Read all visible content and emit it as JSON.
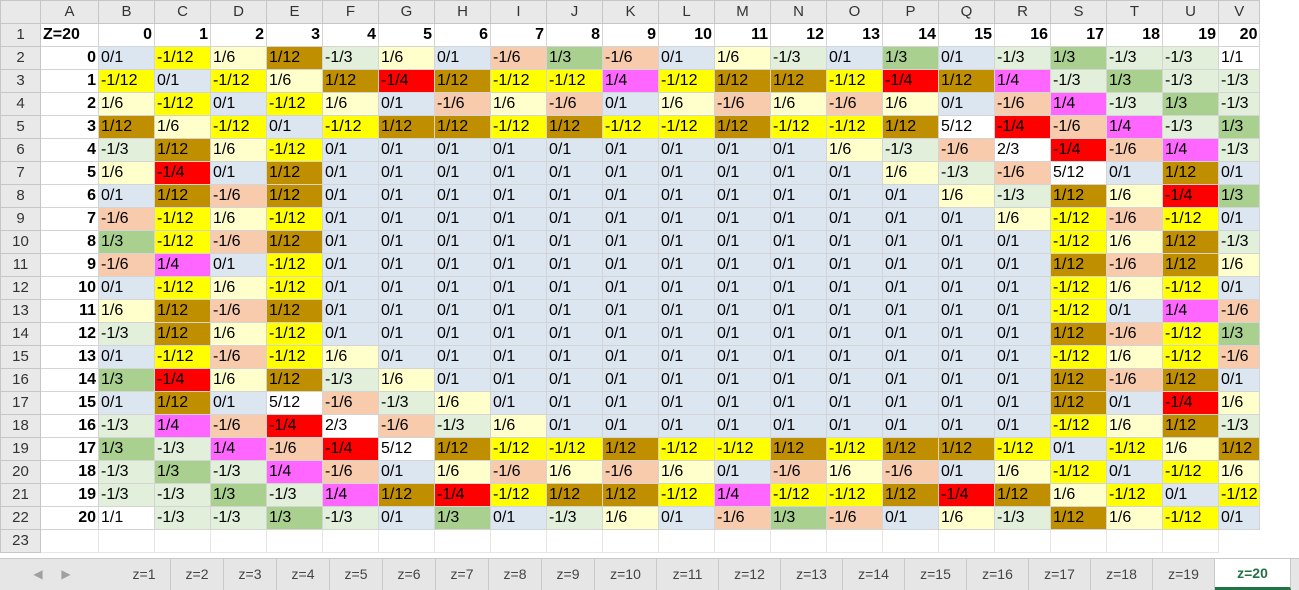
{
  "corner_label": "",
  "column_letters": [
    "A",
    "B",
    "C",
    "D",
    "E",
    "F",
    "G",
    "H",
    "I",
    "J",
    "K",
    "L",
    "M",
    "N",
    "O",
    "P",
    "Q",
    "R",
    "S",
    "T",
    "U",
    "V"
  ],
  "row_numbers": [
    "1",
    "2",
    "3",
    "4",
    "5",
    "6",
    "7",
    "8",
    "9",
    "10",
    "11",
    "12",
    "13",
    "14",
    "15",
    "16",
    "17",
    "18",
    "19",
    "20",
    "21",
    "22",
    "23"
  ],
  "z_label": "Z=20",
  "x_headers": [
    "0",
    "1",
    "2",
    "3",
    "4",
    "5",
    "6",
    "7",
    "8",
    "9",
    "10",
    "11",
    "12",
    "13",
    "14",
    "15",
    "16",
    "17",
    "18",
    "19",
    "20"
  ],
  "y_headers": [
    "0",
    "1",
    "2",
    "3",
    "4",
    "5",
    "6",
    "7",
    "8",
    "9",
    "10",
    "11",
    "12",
    "13",
    "14",
    "15",
    "16",
    "17",
    "18",
    "19",
    "20"
  ],
  "rows": [
    [
      "0/1",
      "-1/12",
      "1/6",
      "1/12",
      "-1/3",
      "1/6",
      "0/1",
      "-1/6",
      "1/3",
      "-1/6",
      "0/1",
      "1/6",
      "-1/3",
      "0/1",
      "1/3",
      "0/1",
      "-1/3",
      "1/3",
      "-1/3",
      "-1/3",
      "1/1"
    ],
    [
      "-1/12",
      "0/1",
      "-1/12",
      "1/6",
      "1/12",
      "-1/4",
      "1/12",
      "-1/12",
      "-1/12",
      "1/4",
      "-1/12",
      "1/12",
      "1/12",
      "-1/12",
      "-1/4",
      "1/12",
      "1/4",
      "-1/3",
      "1/3",
      "-1/3",
      "-1/3"
    ],
    [
      "1/6",
      "-1/12",
      "0/1",
      "-1/12",
      "1/6",
      "0/1",
      "-1/6",
      "1/6",
      "-1/6",
      "0/1",
      "1/6",
      "-1/6",
      "1/6",
      "-1/6",
      "1/6",
      "0/1",
      "-1/6",
      "1/4",
      "-1/3",
      "1/3",
      "-1/3"
    ],
    [
      "1/12",
      "1/6",
      "-1/12",
      "0/1",
      "-1/12",
      "1/12",
      "1/12",
      "-1/12",
      "1/12",
      "-1/12",
      "-1/12",
      "1/12",
      "-1/12",
      "-1/12",
      "1/12",
      "5/12",
      "-1/4",
      "-1/6",
      "1/4",
      "-1/3",
      "1/3"
    ],
    [
      "-1/3",
      "1/12",
      "1/6",
      "-1/12",
      "0/1",
      "0/1",
      "0/1",
      "0/1",
      "0/1",
      "0/1",
      "0/1",
      "0/1",
      "0/1",
      "1/6",
      "-1/3",
      "-1/6",
      "2/3",
      "-1/4",
      "-1/6",
      "1/4",
      "-1/3"
    ],
    [
      "1/6",
      "-1/4",
      "0/1",
      "1/12",
      "0/1",
      "0/1",
      "0/1",
      "0/1",
      "0/1",
      "0/1",
      "0/1",
      "0/1",
      "0/1",
      "0/1",
      "1/6",
      "-1/3",
      "-1/6",
      "5/12",
      "0/1",
      "1/12",
      "0/1"
    ],
    [
      "0/1",
      "1/12",
      "-1/6",
      "1/12",
      "0/1",
      "0/1",
      "0/1",
      "0/1",
      "0/1",
      "0/1",
      "0/1",
      "0/1",
      "0/1",
      "0/1",
      "0/1",
      "1/6",
      "-1/3",
      "1/12",
      "1/6",
      "-1/4",
      "1/3"
    ],
    [
      "-1/6",
      "-1/12",
      "1/6",
      "-1/12",
      "0/1",
      "0/1",
      "0/1",
      "0/1",
      "0/1",
      "0/1",
      "0/1",
      "0/1",
      "0/1",
      "0/1",
      "0/1",
      "0/1",
      "1/6",
      "-1/12",
      "-1/6",
      "-1/12",
      "0/1"
    ],
    [
      "1/3",
      "-1/12",
      "-1/6",
      "1/12",
      "0/1",
      "0/1",
      "0/1",
      "0/1",
      "0/1",
      "0/1",
      "0/1",
      "0/1",
      "0/1",
      "0/1",
      "0/1",
      "0/1",
      "0/1",
      "-1/12",
      "1/6",
      "1/12",
      "-1/3"
    ],
    [
      "-1/6",
      "1/4",
      "0/1",
      "-1/12",
      "0/1",
      "0/1",
      "0/1",
      "0/1",
      "0/1",
      "0/1",
      "0/1",
      "0/1",
      "0/1",
      "0/1",
      "0/1",
      "0/1",
      "0/1",
      "1/12",
      "-1/6",
      "1/12",
      "1/6"
    ],
    [
      "0/1",
      "-1/12",
      "1/6",
      "-1/12",
      "0/1",
      "0/1",
      "0/1",
      "0/1",
      "0/1",
      "0/1",
      "0/1",
      "0/1",
      "0/1",
      "0/1",
      "0/1",
      "0/1",
      "0/1",
      "-1/12",
      "1/6",
      "-1/12",
      "0/1"
    ],
    [
      "1/6",
      "1/12",
      "-1/6",
      "1/12",
      "0/1",
      "0/1",
      "0/1",
      "0/1",
      "0/1",
      "0/1",
      "0/1",
      "0/1",
      "0/1",
      "0/1",
      "0/1",
      "0/1",
      "0/1",
      "-1/12",
      "0/1",
      "1/4",
      "-1/6"
    ],
    [
      "-1/3",
      "1/12",
      "1/6",
      "-1/12",
      "0/1",
      "0/1",
      "0/1",
      "0/1",
      "0/1",
      "0/1",
      "0/1",
      "0/1",
      "0/1",
      "0/1",
      "0/1",
      "0/1",
      "0/1",
      "1/12",
      "-1/6",
      "-1/12",
      "1/3"
    ],
    [
      "0/1",
      "-1/12",
      "-1/6",
      "-1/12",
      "1/6",
      "0/1",
      "0/1",
      "0/1",
      "0/1",
      "0/1",
      "0/1",
      "0/1",
      "0/1",
      "0/1",
      "0/1",
      "0/1",
      "0/1",
      "-1/12",
      "1/6",
      "-1/12",
      "-1/6"
    ],
    [
      "1/3",
      "-1/4",
      "1/6",
      "1/12",
      "-1/3",
      "1/6",
      "0/1",
      "0/1",
      "0/1",
      "0/1",
      "0/1",
      "0/1",
      "0/1",
      "0/1",
      "0/1",
      "0/1",
      "0/1",
      "1/12",
      "-1/6",
      "1/12",
      "0/1"
    ],
    [
      "0/1",
      "1/12",
      "0/1",
      "5/12",
      "-1/6",
      "-1/3",
      "1/6",
      "0/1",
      "0/1",
      "0/1",
      "0/1",
      "0/1",
      "0/1",
      "0/1",
      "0/1",
      "0/1",
      "0/1",
      "1/12",
      "0/1",
      "-1/4",
      "1/6"
    ],
    [
      "-1/3",
      "1/4",
      "-1/6",
      "-1/4",
      "2/3",
      "-1/6",
      "-1/3",
      "1/6",
      "0/1",
      "0/1",
      "0/1",
      "0/1",
      "0/1",
      "0/1",
      "0/1",
      "0/1",
      "0/1",
      "-1/12",
      "1/6",
      "1/12",
      "-1/3"
    ],
    [
      "1/3",
      "-1/3",
      "1/4",
      "-1/6",
      "-1/4",
      "5/12",
      "1/12",
      "-1/12",
      "-1/12",
      "1/12",
      "-1/12",
      "-1/12",
      "1/12",
      "-1/12",
      "1/12",
      "1/12",
      "-1/12",
      "0/1",
      "-1/12",
      "1/6",
      "1/12"
    ],
    [
      "-1/3",
      "1/3",
      "-1/3",
      "1/4",
      "-1/6",
      "0/1",
      "1/6",
      "-1/6",
      "1/6",
      "-1/6",
      "1/6",
      "0/1",
      "-1/6",
      "1/6",
      "-1/6",
      "0/1",
      "1/6",
      "-1/12",
      "0/1",
      "-1/12",
      "1/6"
    ],
    [
      "-1/3",
      "-1/3",
      "1/3",
      "-1/3",
      "1/4",
      "1/12",
      "-1/4",
      "-1/12",
      "1/12",
      "1/12",
      "-1/12",
      "1/4",
      "-1/12",
      "-1/12",
      "1/12",
      "-1/4",
      "1/12",
      "1/6",
      "-1/12",
      "0/1",
      "-1/12"
    ],
    [
      "1/1",
      "-1/3",
      "-1/3",
      "1/3",
      "-1/3",
      "0/1",
      "1/3",
      "0/1",
      "-1/3",
      "1/6",
      "0/1",
      "-1/6",
      "1/3",
      "-1/6",
      "0/1",
      "1/6",
      "-1/3",
      "1/12",
      "1/6",
      "-1/12",
      "0/1"
    ]
  ],
  "value_colors": {
    "0/1": "#dce6f1",
    "1/12": "#bf8f00",
    "-1/12": "#ffff00",
    "1/6": "#ffffcc",
    "-1/6": "#f8cbad",
    "1/4": "#ff66ff",
    "-1/4": "#ff0000",
    "1/3": "#a9d08e",
    "-1/3": "#e2efda",
    "5/12": "#ffffff",
    "2/3": "#ffffff",
    "1/1": "#ffffff"
  },
  "sheet_tabs": [
    "z=1",
    "z=2",
    "z=3",
    "z=4",
    "z=5",
    "z=6",
    "z=7",
    "z=8",
    "z=9",
    "z=10",
    "z=11",
    "z=12",
    "z=13",
    "z=14",
    "z=15",
    "z=16",
    "z=17",
    "z=18",
    "z=19",
    "z=20"
  ],
  "active_tab": "z=20",
  "nav_prev_icon": "chevron-left-icon",
  "nav_next_icon": "chevron-right-icon"
}
